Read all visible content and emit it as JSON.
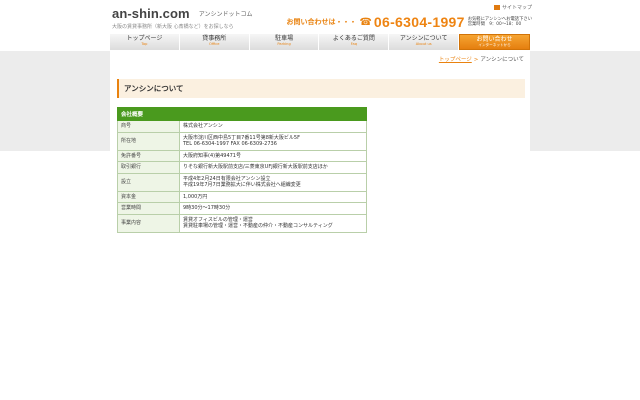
{
  "header": {
    "logo": "an-shin.com",
    "logo_sub": "アンシンドットコム",
    "tagline": "大阪の賃貸事務所（新大阪 心斎橋など）をお探しなら",
    "sitemap": "サイトマップ",
    "contact_label": "お問い合わせは・・・",
    "phone": "06-6304-1997",
    "hours_line1": "お気軽にアンシンへお電話下さい",
    "hours_line2": "営業時間　9：00〜18：00"
  },
  "nav": [
    {
      "jp": "トップページ",
      "en": "Top"
    },
    {
      "jp": "貸事務所",
      "en": "Office"
    },
    {
      "jp": "駐車場",
      "en": "Parking"
    },
    {
      "jp": "よくあるご質問",
      "en": "Faq"
    },
    {
      "jp": "アンシンについて",
      "en": "About us"
    },
    {
      "jp": "お問い合わせ",
      "en": "インターネットから"
    }
  ],
  "breadcrumb": {
    "home": "トップページ",
    "sep": ">",
    "current": "アンシンについて"
  },
  "page_title": "アンシンについて",
  "table": {
    "heading": "会社概要",
    "rows": [
      {
        "key": "商号",
        "value": [
          "株式会社アンシン"
        ]
      },
      {
        "key": "所在地",
        "value": [
          "大阪市淀川区西中島5丁目7番11号第8新大阪ビル5F",
          "TEL 06-6304-1997 FAX 06-6309-2736"
        ]
      },
      {
        "key": "免許番号",
        "value": [
          "大阪府知事(4)第49471号"
        ]
      },
      {
        "key": "取引銀行",
        "value": [
          "りそな銀行新大阪駅前支店/三菱東京UFJ銀行新大阪駅前支店ほか"
        ]
      },
      {
        "key": "設立",
        "value": [
          "平成4年2月24日有限会社アンシン設立",
          "平成19年7月7日業務拡大に伴い株式会社へ組織変更"
        ]
      },
      {
        "key": "資本金",
        "value": [
          "1,000万円"
        ]
      },
      {
        "key": "営業時間",
        "value": [
          "9時30分〜17時30分"
        ]
      },
      {
        "key": "事業内容",
        "value": [
          "賃貸オフィスビルの管理・運営",
          "賃貸駐車場の管理・運営・不動産の仲介・不動産コンサルティング"
        ]
      }
    ]
  },
  "colors": {
    "accent": "#e9820f",
    "table_head": "#4a9a1e",
    "table_key_bg": "#eef5e6",
    "band": "#ececec"
  }
}
